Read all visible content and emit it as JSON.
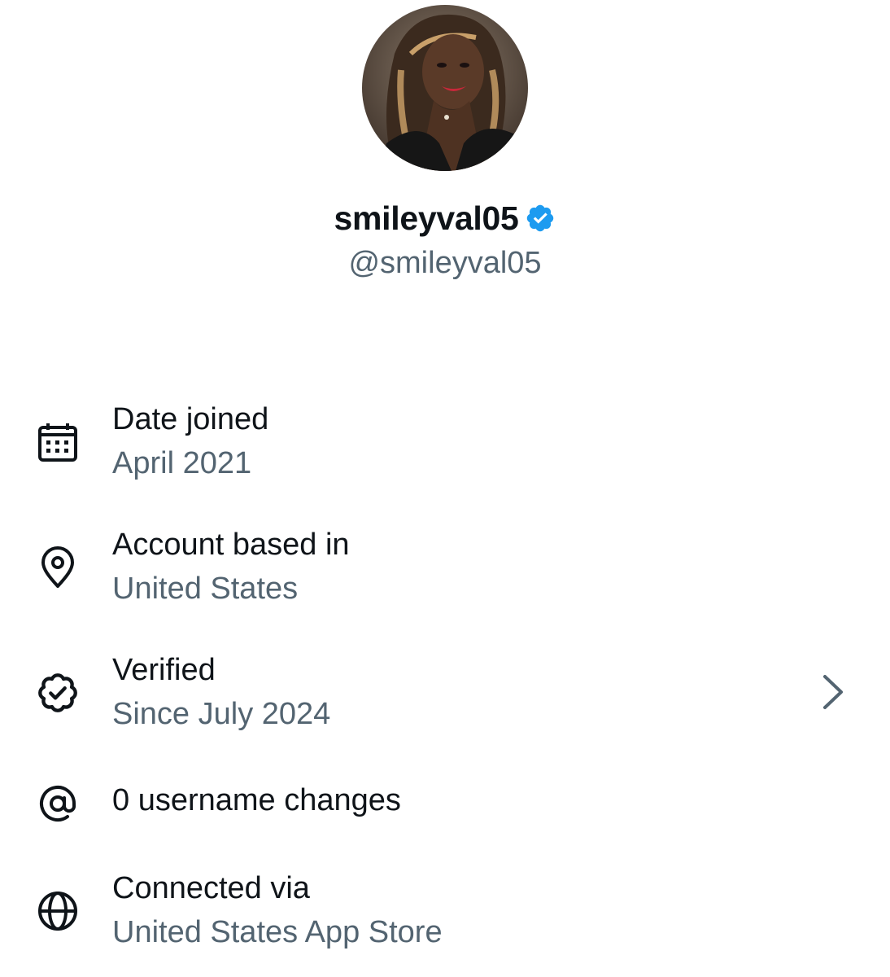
{
  "profile": {
    "display_name": "smileyval05",
    "handle": "@smileyval05",
    "verified_badge_color": "#1d9bf0",
    "avatar": "profile-photo"
  },
  "details": {
    "date_joined": {
      "title": "Date joined",
      "value": "April 2021",
      "icon": "calendar-icon"
    },
    "location": {
      "title": "Account based in",
      "value": "United States",
      "icon": "location-pin-icon"
    },
    "verified": {
      "title": "Verified",
      "value": "Since July 2024",
      "icon": "verified-badge-icon",
      "action_icon": "chevron-right-icon"
    },
    "username_changes": {
      "title": "0 username changes",
      "icon": "at-sign-icon"
    },
    "connected_via": {
      "title": "Connected via",
      "value": "United States App Store",
      "icon": "globe-icon"
    }
  },
  "colors": {
    "primary_text": "#0f1419",
    "secondary_text": "#536471",
    "accent": "#1d9bf0",
    "background": "#ffffff"
  }
}
